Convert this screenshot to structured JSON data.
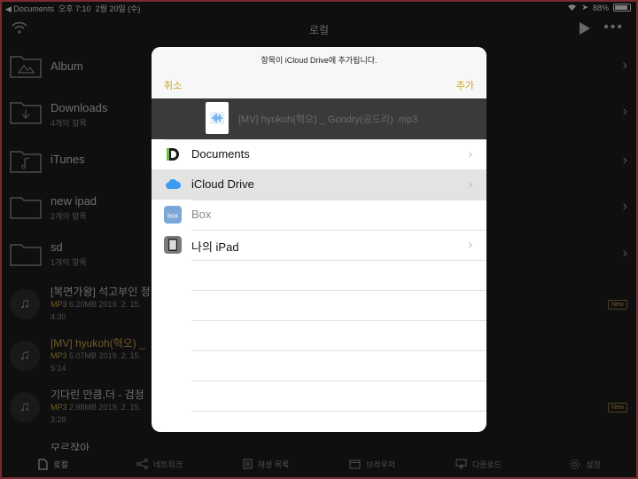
{
  "status": {
    "back_app": "Documents",
    "time": "오후 7:10",
    "date": "2월 20일 (수)",
    "battery": "88%"
  },
  "nav": {
    "title": "로컬"
  },
  "folders": [
    {
      "name": "Album",
      "sub": ""
    },
    {
      "name": "Downloads",
      "sub": "4개의 항목"
    },
    {
      "name": "iTunes",
      "sub": ""
    },
    {
      "name": "new ipad",
      "sub": "2개의 항목"
    },
    {
      "name": "sd",
      "sub": "1개의 항목"
    }
  ],
  "files": [
    {
      "name": "[복면가왕] 석고부인 정",
      "meta_type": "MP3",
      "meta": "6.20MB 2019. 2. 15.",
      "duration": "4:30",
      "badge": "New"
    },
    {
      "name": "[MV] hyukoh(혁오) _",
      "meta_type": "MP3",
      "meta": "5.07MB 2019. 2. 15.",
      "duration": "5:14",
      "badge": ""
    },
    {
      "name": "기다린 만큼,더 - 검정",
      "meta_type": "MP3",
      "meta": "2.98MB 2019. 2. 15.",
      "duration": "3:28",
      "badge": "New"
    },
    {
      "name": "모르잖아",
      "meta_type": "",
      "meta": "",
      "duration": "",
      "badge": ""
    }
  ],
  "tabs": [
    "로컬",
    "네트워크",
    "재생 목록",
    "브라우저",
    "다운로드",
    "설정"
  ],
  "sheet": {
    "message": "항목이 iCloud Drive에 추가됩니다.",
    "cancel": "취소",
    "add": "추가",
    "file_name": "[MV] hyukoh(혁오) _ Gondry(공드리) .mp3",
    "locations": [
      {
        "label": "Documents",
        "icon": "documents-app-icon",
        "chevron": "›"
      },
      {
        "label": "iCloud Drive",
        "icon": "icloud-icon",
        "chevron": "›"
      },
      {
        "label": "Box",
        "icon": "box-icon",
        "chevron": ""
      },
      {
        "label": "나의 iPad",
        "icon": "ipad-icon",
        "chevron": "›"
      }
    ]
  },
  "colors": {
    "accent": "#d4a020",
    "file_highlight": "#c9a445"
  }
}
